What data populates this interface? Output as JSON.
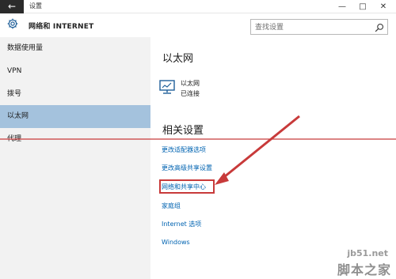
{
  "window": {
    "back_label": "←",
    "title": "设置",
    "minimize": "—",
    "maximize": "□",
    "close": "✕"
  },
  "header": {
    "title": "网络和 INTERNET",
    "search_placeholder": "查找设置",
    "icon": "gear-icon"
  },
  "sidebar": {
    "items": [
      {
        "label": "数据使用量"
      },
      {
        "label": "VPN"
      },
      {
        "label": "拨号"
      },
      {
        "label": "以太网"
      },
      {
        "label": "代理"
      }
    ],
    "active_index": 3
  },
  "main": {
    "section_title": "以太网",
    "connection": {
      "name": "以太网",
      "status": "已连接",
      "icon": "monitor-network-icon"
    },
    "related_title": "相关设置",
    "links": [
      {
        "label": "更改适配器选项"
      },
      {
        "label": "更改高级共享设置"
      },
      {
        "label": "网络和共享中心"
      },
      {
        "label": "家庭组"
      },
      {
        "label": "Internet 选项"
      },
      {
        "label": "Windows"
      }
    ],
    "highlighted_link_index": 2
  },
  "watermark": {
    "url": "jb51.net",
    "text": "脚本之家"
  },
  "colors": {
    "accent_link": "#0063b1",
    "sidebar_active": "#a4c2dd",
    "sidebar_bg": "#f2f2f2",
    "annotation": "#c83a3a"
  }
}
